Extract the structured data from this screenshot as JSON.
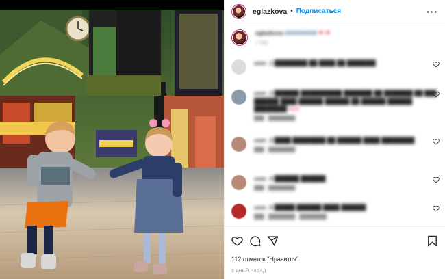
{
  "header": {
    "username": "eglazkova",
    "separator": "•",
    "follow_label": "Подписаться",
    "more_label": "···"
  },
  "caption": {
    "username": "eglazkova",
    "text": "❤ ❤",
    "time": "1 нед."
  },
  "comments": [
    {
      "username": "user_1",
      "text": "",
      "time": "",
      "reply": ""
    },
    {
      "username": "user_2",
      "text": "",
      "time": "",
      "reply": ""
    },
    {
      "username": "user_3",
      "text": "",
      "time": "",
      "reply": ""
    },
    {
      "username": "user_4",
      "text": "",
      "time": "",
      "reply": ""
    },
    {
      "username": "user_5",
      "text": "",
      "time": "",
      "reply": ""
    }
  ],
  "actions": {
    "like_icon": "heart-icon",
    "comment_icon": "comment-icon",
    "share_icon": "share-icon",
    "save_icon": "bookmark-icon"
  },
  "likes_text": "112 отметок \"Нравится\"",
  "date_text": "3 ДНЕЙ НАЗАД",
  "colors": {
    "link_blue": "#0095f6",
    "text": "#262626",
    "muted": "#8e8e8e",
    "heart_red": "#ed4956"
  }
}
